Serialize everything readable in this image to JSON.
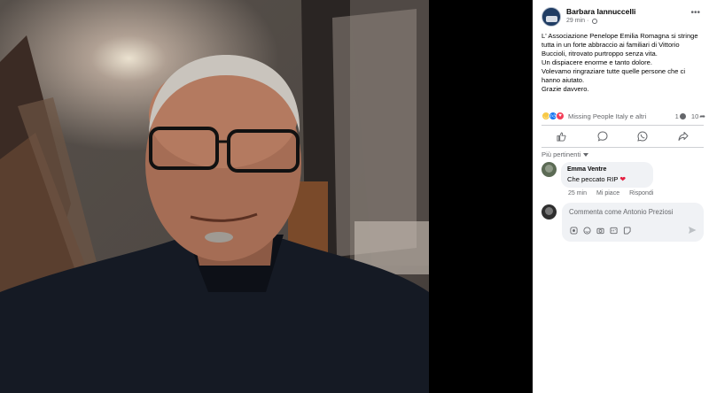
{
  "photo": {
    "alt": "Foto"
  },
  "post": {
    "author": "Barbara Iannuccelli",
    "time": "29 min",
    "text": [
      "L' Associazione Penelope Emilia Romagna si stringe tutta in un forte abbraccio ai familiari di Vittorio Buccioli, ritrovato purtroppo senza vita.",
      "Un dispiacere enorme e tanto dolore.",
      "Volevamo ringraziare tutte quelle persone che ci hanno aiutato.",
      "Grazie davvero."
    ]
  },
  "reactions": {
    "names": "Missing People Italy e altri",
    "comments_count": "1",
    "shares_count": "10"
  },
  "sort": {
    "label": "Più pertinenti"
  },
  "comment": {
    "author": "Emma Ventre",
    "text": "Che peccato RIP",
    "time": "25 min",
    "like": "Mi piace",
    "reply": "Rispondi"
  },
  "composer": {
    "placeholder": "Commenta come Antonio Preziosi"
  },
  "colors": {
    "facebook_blue": "#1877f2",
    "secondary_text": "#65676b",
    "bubble_bg": "#f0f2f5",
    "heart": "#e41e3f"
  },
  "icons": {
    "more": "more-icon",
    "like": "like-icon",
    "comment": "comment-icon",
    "whatsapp": "whatsapp-icon",
    "share": "share-icon"
  }
}
